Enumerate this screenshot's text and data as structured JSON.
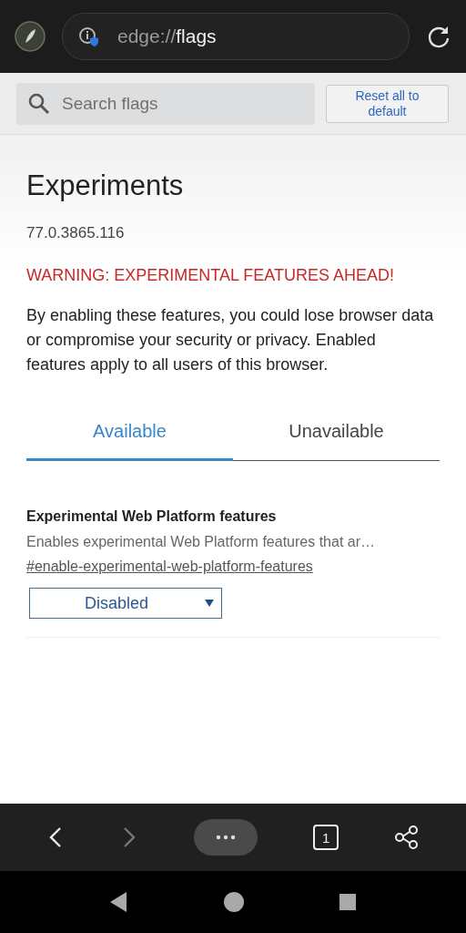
{
  "address_bar": {
    "scheme": "edge://",
    "path": "flags"
  },
  "search": {
    "placeholder": "Search flags"
  },
  "reset_button": "Reset all to default",
  "title": "Experiments",
  "version": "77.0.3865.116",
  "warning": "WARNING: EXPERIMENTAL FEATURES AHEAD!",
  "description": "By enabling these features, you could lose browser data or compromise your security or privacy. Enabled features apply to all users of this browser.",
  "tabs": [
    {
      "label": "Available",
      "selected": true
    },
    {
      "label": "Unavailable",
      "selected": false
    }
  ],
  "flags": [
    {
      "name": "Experimental Web Platform features",
      "description": "Enables experimental Web Platform features that ar…",
      "link": "#enable-experimental-web-platform-features",
      "value": "Disabled"
    }
  ],
  "toolbar": {
    "back_disabled": false,
    "forward_disabled": true,
    "tab_count": "1"
  }
}
